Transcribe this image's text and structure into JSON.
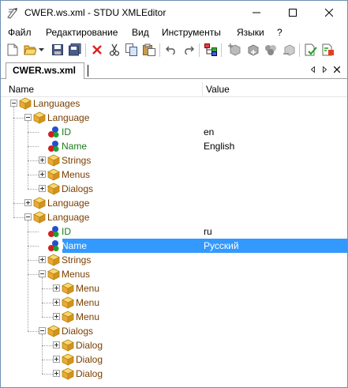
{
  "window": {
    "title": "CWER.ws.xml - STDU XMLEditor"
  },
  "menu": [
    {
      "label": "Файл"
    },
    {
      "label": "Редактирование"
    },
    {
      "label": "Вид"
    },
    {
      "label": "Инструменты"
    },
    {
      "label": "Языки"
    },
    {
      "label": "?"
    }
  ],
  "toolbar": {
    "icons": [
      "new-file-icon",
      "open-folder-icon",
      "dropdown-arrow-icon",
      "save-icon",
      "save-all-icon",
      "delete-icon",
      "cut-icon",
      "copy-icon",
      "paste-icon",
      "undo-icon",
      "redo-icon",
      "tree-view-icon",
      "add-node-icon",
      "add-child-icon",
      "add-attribute-icon",
      "add-text-icon",
      "validate-icon",
      "export-icon"
    ]
  },
  "tab": {
    "label": "CWER.ws.xml"
  },
  "columns": {
    "name": "Name",
    "value": "Value"
  },
  "tree": [
    {
      "label": "Languages",
      "type": "element",
      "expanded": true,
      "value": ""
    },
    {
      "label": "Language",
      "type": "element",
      "expanded": true,
      "value": ""
    },
    {
      "label": "ID",
      "type": "attribute",
      "value": "en"
    },
    {
      "label": "Name",
      "type": "attribute",
      "value": "English"
    },
    {
      "label": "Strings",
      "type": "element",
      "expanded": false,
      "value": ""
    },
    {
      "label": "Menus",
      "type": "element",
      "expanded": false,
      "value": ""
    },
    {
      "label": "Dialogs",
      "type": "element",
      "expanded": false,
      "value": ""
    },
    {
      "label": "Language",
      "type": "element",
      "expanded": false,
      "value": ""
    },
    {
      "label": "Language",
      "type": "element",
      "expanded": true,
      "value": ""
    },
    {
      "label": "ID",
      "type": "attribute",
      "value": "ru"
    },
    {
      "label": "Name",
      "type": "attribute",
      "value": "Русский",
      "selected": true
    },
    {
      "label": "Strings",
      "type": "element",
      "expanded": false,
      "value": ""
    },
    {
      "label": "Menus",
      "type": "element",
      "expanded": true,
      "value": ""
    },
    {
      "label": "Menu",
      "type": "element",
      "expanded": false,
      "value": ""
    },
    {
      "label": "Menu",
      "type": "element",
      "expanded": false,
      "value": ""
    },
    {
      "label": "Menu",
      "type": "element",
      "expanded": false,
      "value": ""
    },
    {
      "label": "Dialogs",
      "type": "element",
      "expanded": true,
      "value": ""
    },
    {
      "label": "Dialog",
      "type": "element",
      "expanded": false,
      "value": ""
    },
    {
      "label": "Dialog",
      "type": "element",
      "expanded": false,
      "value": ""
    },
    {
      "label": "Dialog",
      "type": "element",
      "expanded": false,
      "value": ""
    }
  ],
  "colors": {
    "selection": "#3399ff",
    "element_text": "#7a3e00",
    "attribute_text": "#1a7a1a"
  }
}
